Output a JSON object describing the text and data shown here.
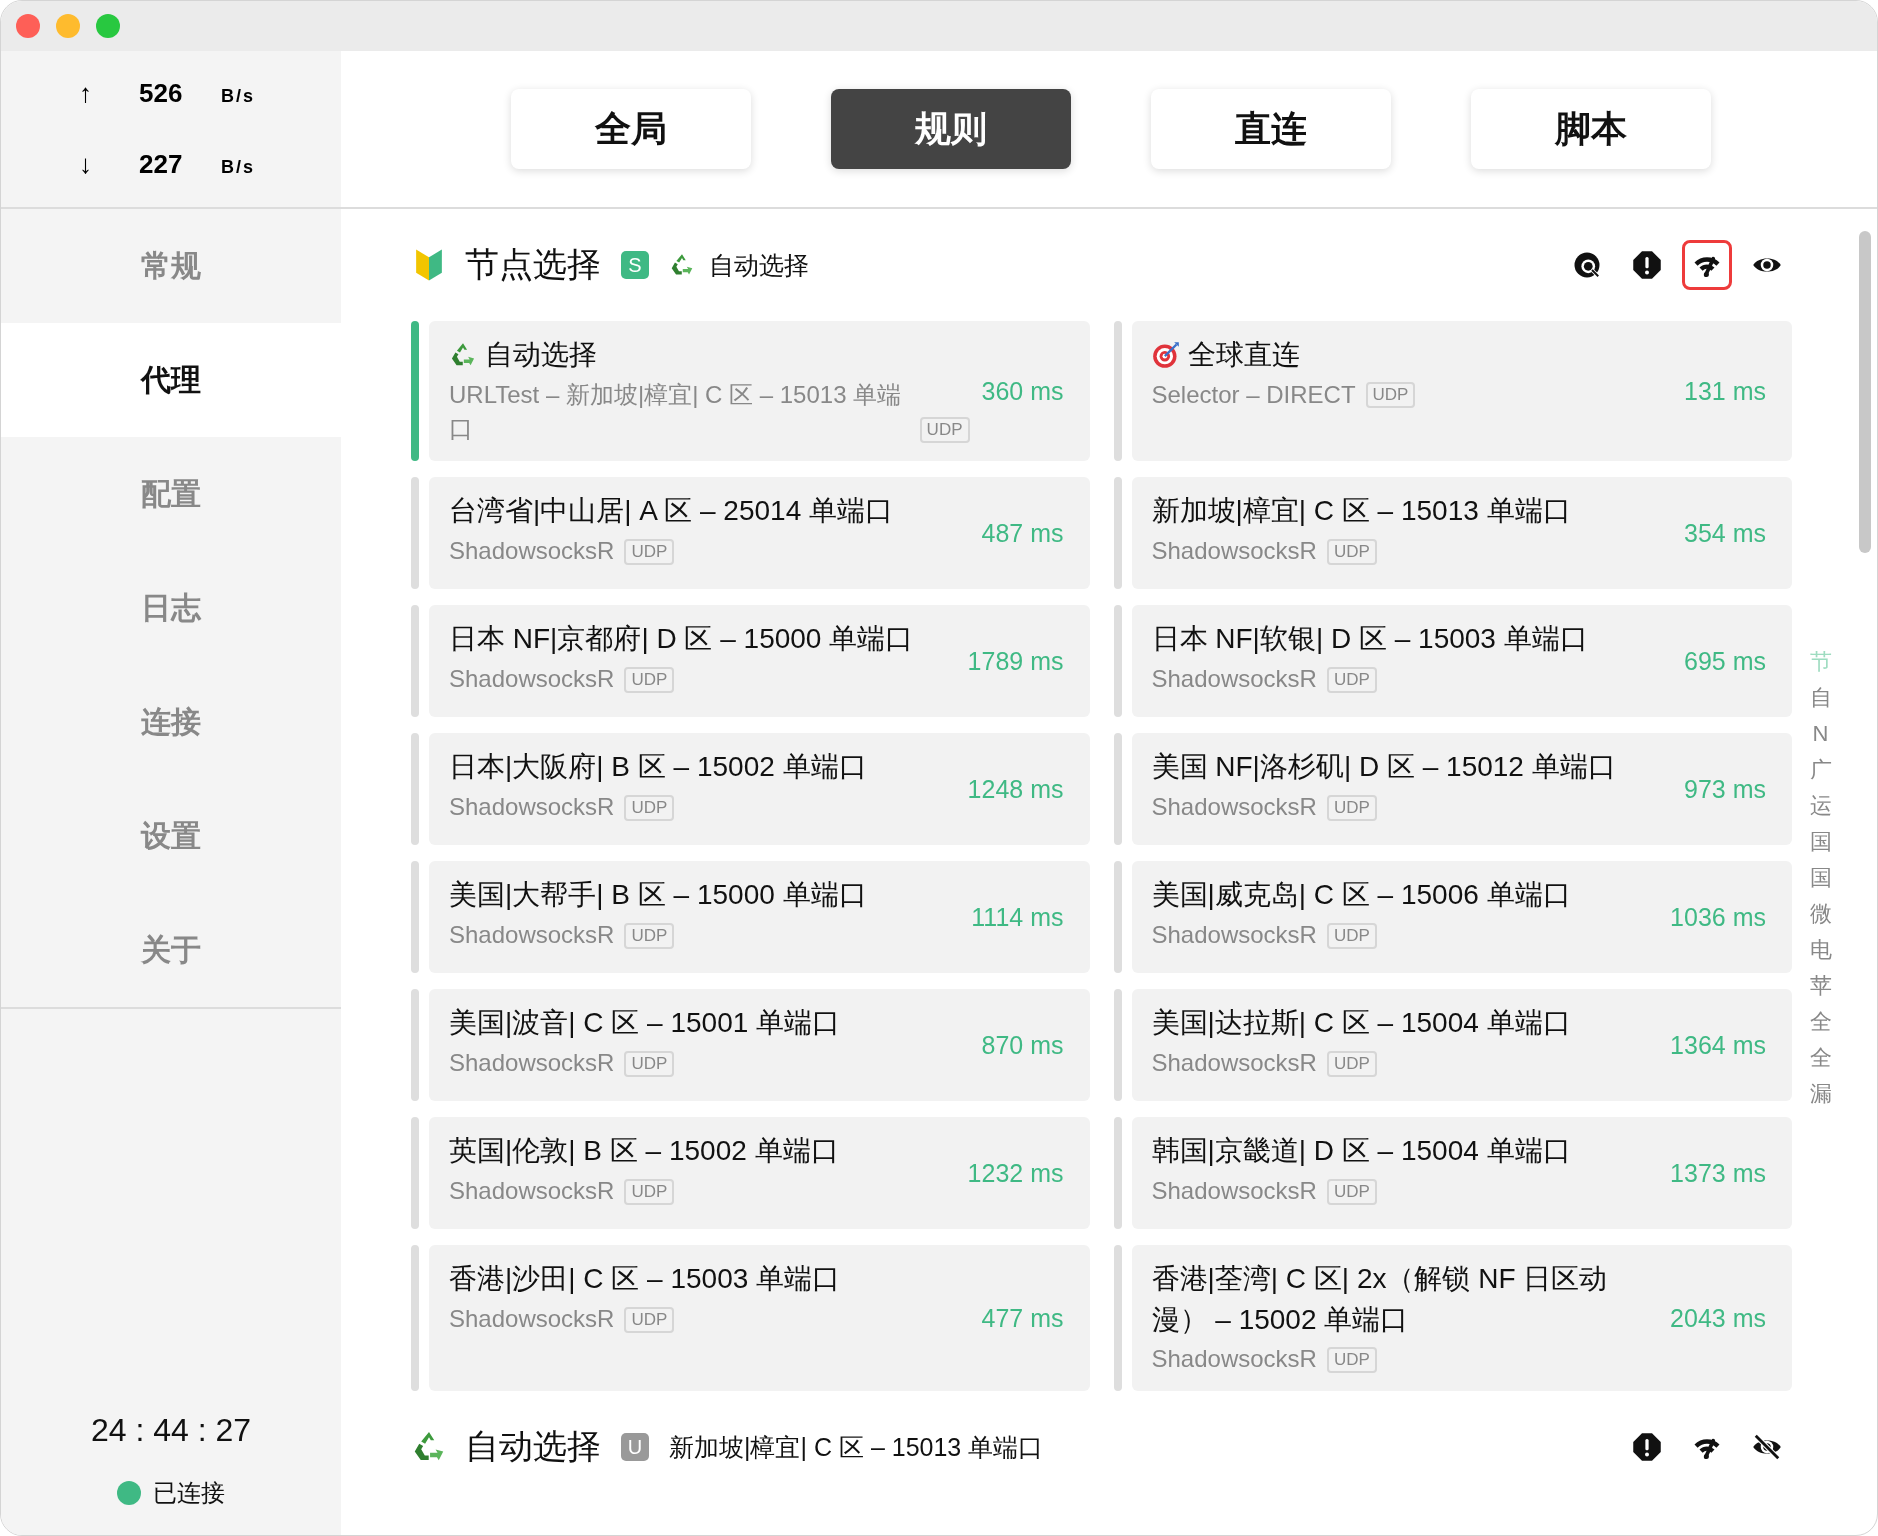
{
  "traffic": [
    {
      "arrow": "↑",
      "value": "526",
      "unit": "B/s"
    },
    {
      "arrow": "↓",
      "value": "227",
      "unit": "B/s"
    }
  ],
  "modes": [
    {
      "label": "全局",
      "selected": false
    },
    {
      "label": "规则",
      "selected": true
    },
    {
      "label": "直连",
      "selected": false
    },
    {
      "label": "脚本",
      "selected": false
    }
  ],
  "sidebar": {
    "items": [
      {
        "label": "常规",
        "selected": false
      },
      {
        "label": "代理",
        "selected": true
      },
      {
        "label": "配置",
        "selected": false
      },
      {
        "label": "日志",
        "selected": false
      },
      {
        "label": "连接",
        "selected": false
      },
      {
        "label": "设置",
        "selected": false
      },
      {
        "label": "关于",
        "selected": false
      }
    ],
    "timer": "24 : 44 : 27",
    "status": {
      "label": "已连接",
      "connected": true
    }
  },
  "groups": [
    {
      "kind": "select",
      "title": "节点选择",
      "badge": {
        "label": "S",
        "color": "#3fb984"
      },
      "current": {
        "kind": "urltest",
        "label": "自动选择"
      },
      "actions": [
        {
          "kind": "locate",
          "highlighted": false
        },
        {
          "kind": "alert",
          "highlighted": false
        },
        {
          "kind": "speed",
          "highlighted": true
        },
        {
          "kind": "visible",
          "highlighted": false
        }
      ],
      "nodes": [
        {
          "kind": "urltest",
          "name": "自动选择",
          "type": "URLTest – 新加坡|樟宜| C 区 – 15013 单端口",
          "tag": "UDP",
          "delay": "360 ms",
          "selected": true
        },
        {
          "kind": "direct",
          "name": "全球直连",
          "type": "Selector – DIRECT",
          "tag": "UDP",
          "delay": "131 ms",
          "selected": false
        },
        {
          "kind": "server",
          "name": "台湾省|中山居| A 区 – 25014 单端口",
          "type": "ShadowsocksR",
          "tag": "UDP",
          "delay": "487 ms",
          "selected": false
        },
        {
          "kind": "server",
          "name": "新加坡|樟宜| C 区 – 15013 单端口",
          "type": "ShadowsocksR",
          "tag": "UDP",
          "delay": "354 ms",
          "selected": false
        },
        {
          "kind": "server",
          "name": "日本 NF|京都府| D 区 – 15000 单端口",
          "type": "ShadowsocksR",
          "tag": "UDP",
          "delay": "1789 ms",
          "selected": false
        },
        {
          "kind": "server",
          "name": "日本 NF|软银| D 区 – 15003 单端口",
          "type": "ShadowsocksR",
          "tag": "UDP",
          "delay": "695 ms",
          "selected": false
        },
        {
          "kind": "server",
          "name": "日本|大阪府| B 区 – 15002 单端口",
          "type": "ShadowsocksR",
          "tag": "UDP",
          "delay": "1248 ms",
          "selected": false
        },
        {
          "kind": "server",
          "name": "美国 NF|洛杉矶| D 区 – 15012 单端口",
          "type": "ShadowsocksR",
          "tag": "UDP",
          "delay": "973 ms",
          "selected": false
        },
        {
          "kind": "server",
          "name": "美国|大帮手| B 区 – 15000 单端口",
          "type": "ShadowsocksR",
          "tag": "UDP",
          "delay": "1114 ms",
          "selected": false
        },
        {
          "kind": "server",
          "name": "美国|威克岛| C 区 – 15006 单端口",
          "type": "ShadowsocksR",
          "tag": "UDP",
          "delay": "1036 ms",
          "selected": false
        },
        {
          "kind": "server",
          "name": "美国|波音| C 区 – 15001 单端口",
          "type": "ShadowsocksR",
          "tag": "UDP",
          "delay": "870 ms",
          "selected": false
        },
        {
          "kind": "server",
          "name": "美国|达拉斯| C 区 – 15004 单端口",
          "type": "ShadowsocksR",
          "tag": "UDP",
          "delay": "1364 ms",
          "selected": false
        },
        {
          "kind": "server",
          "name": "英国|伦敦| B 区 – 15002 单端口",
          "type": "ShadowsocksR",
          "tag": "UDP",
          "delay": "1232 ms",
          "selected": false
        },
        {
          "kind": "server",
          "name": "韩国|京畿道| D 区 – 15004 单端口",
          "type": "ShadowsocksR",
          "tag": "UDP",
          "delay": "1373 ms",
          "selected": false
        },
        {
          "kind": "server",
          "name": "香港|沙田| C 区 – 15003 单端口",
          "type": "ShadowsocksR",
          "tag": "UDP",
          "delay": "477 ms",
          "selected": false
        },
        {
          "kind": "server",
          "name": "香港|荃湾| C 区| 2x（解锁 NF 日区动漫） – 15002 单端口",
          "type": "ShadowsocksR",
          "tag": "UDP",
          "delay": "2043 ms",
          "selected": false
        }
      ]
    },
    {
      "kind": "urltest",
      "title": "自动选择",
      "badge": {
        "label": "U",
        "color": "#999999"
      },
      "current": {
        "kind": "server",
        "label": "新加坡|樟宜| C 区 – 15013 单端口"
      },
      "actions": [
        {
          "kind": "alert",
          "highlighted": false
        },
        {
          "kind": "speed",
          "highlighted": false
        },
        {
          "kind": "hidden",
          "highlighted": false
        }
      ]
    }
  ],
  "index": [
    {
      "label": "节",
      "selected": true
    },
    {
      "label": "自",
      "selected": false
    },
    {
      "label": "N",
      "selected": false
    },
    {
      "label": "广",
      "selected": false
    },
    {
      "label": "运",
      "selected": false
    },
    {
      "label": "国",
      "selected": false
    },
    {
      "label": "国",
      "selected": false
    },
    {
      "label": "微",
      "selected": false
    },
    {
      "label": "电",
      "selected": false
    },
    {
      "label": "苹",
      "selected": false
    },
    {
      "label": "全",
      "selected": false
    },
    {
      "label": "全",
      "selected": false
    },
    {
      "label": "漏",
      "selected": false
    }
  ]
}
